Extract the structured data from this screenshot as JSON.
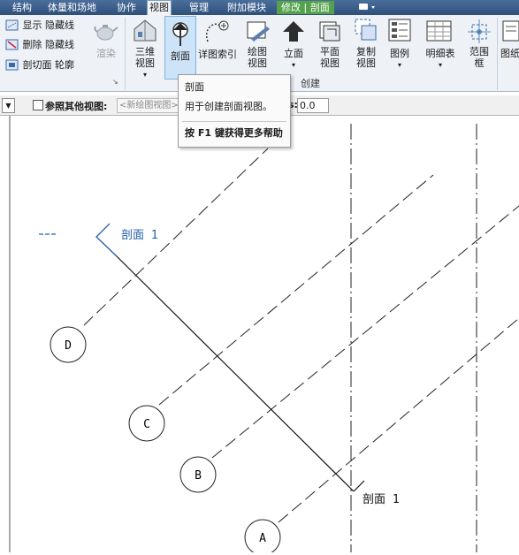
{
  "tabs": [
    {
      "label": "结构"
    },
    {
      "label": "体量和场地"
    },
    {
      "label": "协作"
    },
    {
      "label": "视图"
    },
    {
      "label": "管理"
    },
    {
      "label": "附加模块"
    },
    {
      "label": "修改 | 剖面"
    }
  ],
  "graphics_panel": {
    "show_hidden_lines": "显示 隐藏线",
    "remove_hidden_lines": "删除 隐藏线",
    "cut_profile": "剖切面 轮廓"
  },
  "ribbon": {
    "render": "渲染",
    "three_d_view": [
      "三维",
      "视图"
    ],
    "section": "剖面",
    "callout": "详图索引",
    "drafting_view": [
      "绘图",
      "视图"
    ],
    "elevation": "立面",
    "plan_views": [
      "平面",
      "视图"
    ],
    "duplicate_view": [
      "复制",
      "视图"
    ],
    "legends": "图例",
    "schedules": "明细表",
    "scope_box": [
      "范围",
      "框"
    ],
    "sheet_partial": "图纸",
    "create_panel_title": "创建"
  },
  "options_bar": {
    "reference_other_view": "参照其他视图:",
    "new_drafting_view": "<新绘图视图>",
    "offset_value": "0.0",
    "offset_suffix": "s:"
  },
  "tooltip": {
    "title": "剖面",
    "description": "用于创建剖面视图。",
    "help": "按 F1 键获得更多帮助"
  },
  "drawing": {
    "section_label_top": "剖面 1",
    "section_label_bottom": "剖面 1",
    "grid_labels": [
      "D",
      "C",
      "B",
      "A"
    ],
    "dash_mark": "---"
  },
  "colors": {
    "tabbar": "#2f4f7a",
    "context_tab": "#55a24d",
    "section_head": "#1f5fa8",
    "tooltip_bg": "#fafafa"
  }
}
